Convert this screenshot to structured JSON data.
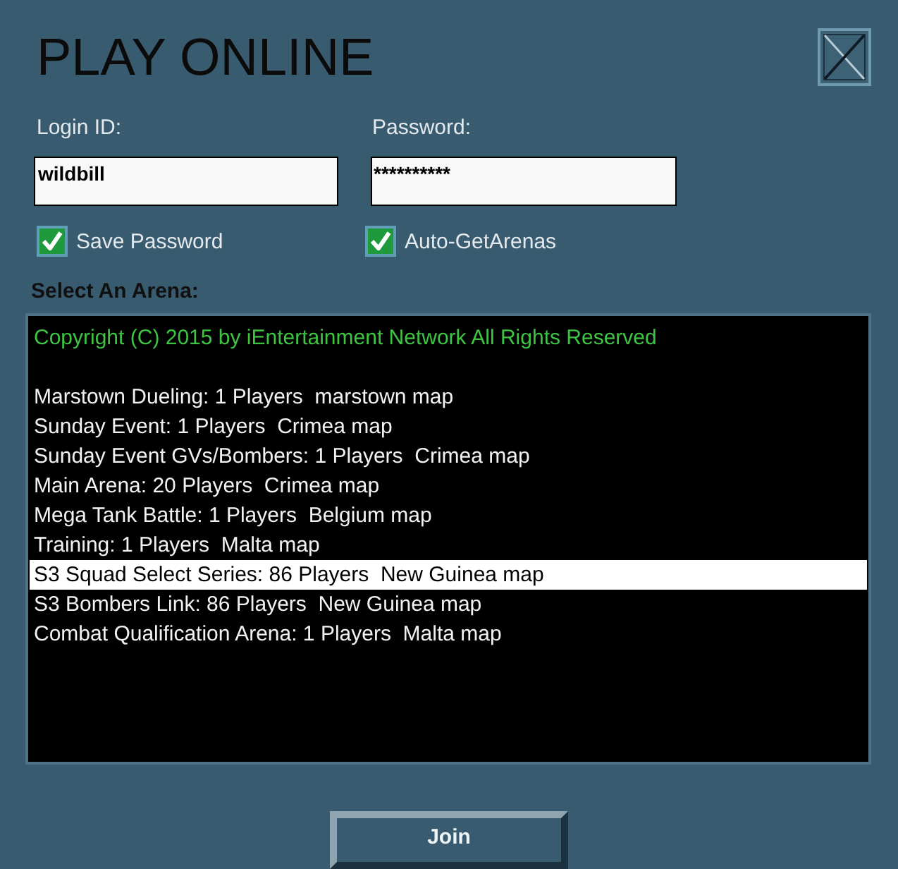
{
  "window": {
    "title": "PLAY ONLINE"
  },
  "login": {
    "label": "Login ID:",
    "value": "wildbill"
  },
  "password": {
    "label": "Password:",
    "value": "**********"
  },
  "options": [
    {
      "label": "Save Password",
      "checked": true
    },
    {
      "label": "Auto-GetArenas",
      "checked": true
    }
  ],
  "arena_list": {
    "label": "Select An Arena:",
    "notice": "Copyright (C) 2015 by iEntertainment Network All Rights Reserved",
    "items": [
      {
        "label": "Marstown Dueling: 1 Players  marstown map",
        "selected": false
      },
      {
        "label": "Sunday Event: 1 Players  Crimea map",
        "selected": false
      },
      {
        "label": "Sunday Event GVs/Bombers: 1 Players  Crimea map",
        "selected": false
      },
      {
        "label": "Main Arena: 20 Players  Crimea map",
        "selected": false
      },
      {
        "label": "Mega Tank Battle: 1 Players  Belgium map",
        "selected": false
      },
      {
        "label": "Training: 1 Players  Malta map",
        "selected": false
      },
      {
        "label": "S3 Squad Select Series: 86 Players  New Guinea map",
        "selected": true
      },
      {
        "label": "S3 Bombers Link: 86 Players  New Guinea map",
        "selected": false
      },
      {
        "label": "Combat Qualification Arena: 1 Players  Malta map",
        "selected": false
      }
    ]
  },
  "join_button": {
    "label": "Join"
  }
}
